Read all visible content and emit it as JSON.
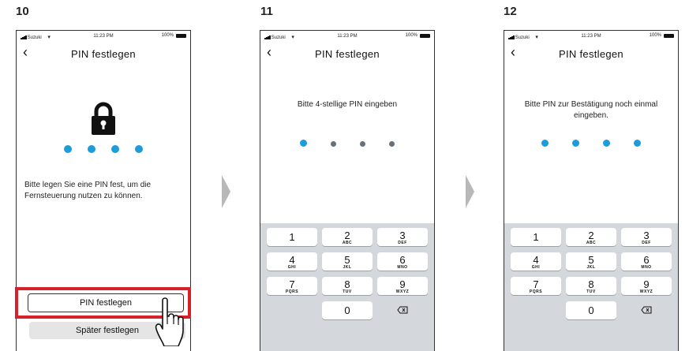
{
  "steps": [
    {
      "number": "10",
      "status": {
        "carrier": "Suzuki",
        "time": "11:23 PM",
        "battery": "100%"
      },
      "nav": {
        "back_icon": "chevron-left-icon",
        "title": "PIN festlegen"
      },
      "lock_icon": "lock-icon",
      "pin_entered": 4,
      "info_text": "Bitte legen Sie eine PIN fest, um die Fernsteuerung nutzen zu können.",
      "primary_button": "PIN festlegen",
      "secondary_button": "Später festlegen"
    },
    {
      "number": "11",
      "status": {
        "carrier": "Suzuki",
        "time": "11:23 PM",
        "battery": "100%"
      },
      "nav": {
        "back_icon": "chevron-left-icon",
        "title": "PIN festlegen"
      },
      "prompt": "Bitte 4-stellige PIN eingeben",
      "pin_entered": 1
    },
    {
      "number": "12",
      "status": {
        "carrier": "Suzuki",
        "time": "11:23 PM",
        "battery": "100%"
      },
      "nav": {
        "back_icon": "chevron-left-icon",
        "title": "PIN festlegen"
      },
      "prompt": "Bitte PIN zur Bestätigung noch einmal eingeben.",
      "pin_entered": 4
    }
  ],
  "keypad": [
    {
      "digit": "1",
      "letters": ""
    },
    {
      "digit": "2",
      "letters": "ABC"
    },
    {
      "digit": "3",
      "letters": "DEF"
    },
    {
      "digit": "4",
      "letters": "GHI"
    },
    {
      "digit": "5",
      "letters": "JKL"
    },
    {
      "digit": "6",
      "letters": "MNO"
    },
    {
      "digit": "7",
      "letters": "PQRS"
    },
    {
      "digit": "8",
      "letters": "TUV"
    },
    {
      "digit": "9",
      "letters": "WXYZ"
    },
    {
      "digit": "0",
      "letters": ""
    }
  ],
  "keypad_delete_icon": "backspace-icon",
  "colors": {
    "pin_filled": "#1e9bdb",
    "pin_empty": "#6a7077",
    "highlight": "#d6202a",
    "keypad_bg": "#d4d7dc",
    "arrow": "#b8b8b8"
  },
  "step_arrow_icon": "chevron-right-arrow-icon",
  "hand_icon": "pointing-hand-icon"
}
